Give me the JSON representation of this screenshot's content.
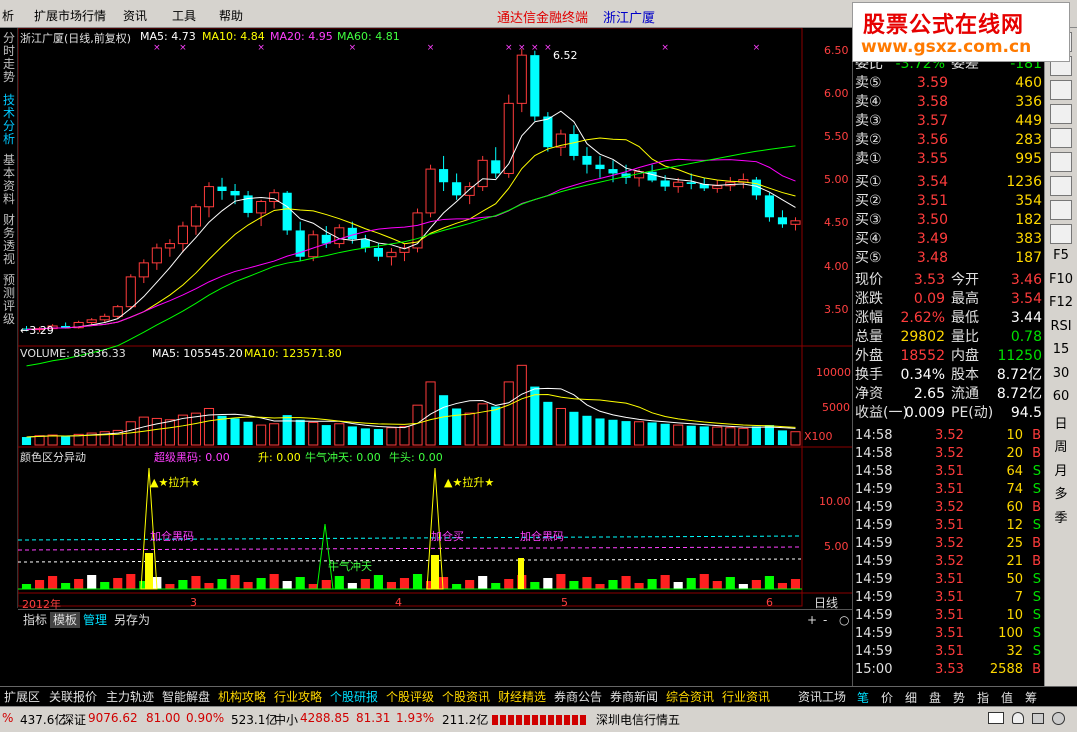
{
  "menu": {
    "items": [
      "析",
      "扩展市场行情",
      "资讯",
      "工具",
      "帮助"
    ],
    "brand": "通达信金融终端",
    "stock": "浙江广厦"
  },
  "logo": {
    "title": "股票公式在线网",
    "url": "www.gsxz.com.cn"
  },
  "left_tabs": [
    "分时走势",
    "技术分析",
    "基本资料",
    "财务透视",
    "预测评级"
  ],
  "main_header": {
    "name": "浙江广厦(日线,前复权)",
    "ma5": "MA5: 4.73",
    "ma10": "MA10: 4.84",
    "ma20": "MA20: 4.95",
    "ma60": "MA60: 4.81"
  },
  "price_axis": [
    "6.50",
    "6.00",
    "5.50",
    "5.00",
    "4.50",
    "4.00",
    "3.50"
  ],
  "price_marks": {
    "high": "6.52",
    "low": "3.29"
  },
  "volume_header": {
    "label": "VOLUME: 85836.33",
    "ma5": "MA5: 105545.20",
    "ma10": "MA10: 123571.80"
  },
  "volume_axis": [
    "10000",
    "5000",
    "X100"
  ],
  "indicator_header": {
    "name": "颜色区分异动",
    "v1": "超级黑码: 0.00",
    "v2": "升: 0.00",
    "v3": "牛气冲天: 0.00",
    "v4": "牛头: 0.00"
  },
  "indicator_axis": [
    "10.00",
    "5.00"
  ],
  "indicator_labels": {
    "lift1": "▲★拉升★",
    "lift2": "▲★拉升★",
    "heima1": "加仓黑码",
    "heima2": "加仓黑码",
    "jiacang": "加仓买",
    "niu": "牛气冲天"
  },
  "time_axis": [
    "2012年",
    "3",
    "4",
    "5",
    "6"
  ],
  "period": "日线",
  "chart_toolbar": [
    "指标",
    "模板",
    "管理",
    "另存为"
  ],
  "quote": {
    "weibi_label": "委比",
    "weibi": "-3.72%",
    "weicha_label": "委差",
    "weicha": "-181",
    "sell": [
      {
        "label": "卖⑤",
        "price": "3.59",
        "vol": "460"
      },
      {
        "label": "卖④",
        "price": "3.58",
        "vol": "336"
      },
      {
        "label": "卖③",
        "price": "3.57",
        "vol": "449"
      },
      {
        "label": "卖②",
        "price": "3.56",
        "vol": "283"
      },
      {
        "label": "卖①",
        "price": "3.55",
        "vol": "995"
      }
    ],
    "buy": [
      {
        "label": "买①",
        "price": "3.54",
        "vol": "1236"
      },
      {
        "label": "买②",
        "price": "3.51",
        "vol": "354"
      },
      {
        "label": "买③",
        "price": "3.50",
        "vol": "182"
      },
      {
        "label": "买④",
        "price": "3.49",
        "vol": "383"
      },
      {
        "label": "买⑤",
        "price": "3.48",
        "vol": "187"
      }
    ],
    "stats": [
      {
        "l1": "现价",
        "v1": "3.53",
        "c1": "red",
        "l2": "今开",
        "v2": "3.46",
        "c2": "red"
      },
      {
        "l1": "涨跌",
        "v1": "0.09",
        "c1": "red",
        "l2": "最高",
        "v2": "3.54",
        "c2": "red"
      },
      {
        "l1": "涨幅",
        "v1": "2.62%",
        "c1": "red",
        "l2": "最低",
        "v2": "3.44",
        "c2": "white"
      },
      {
        "l1": "总量",
        "v1": "29802",
        "c1": "yellow",
        "l2": "量比",
        "v2": "0.78",
        "c2": "green"
      },
      {
        "l1": "外盘",
        "v1": "18552",
        "c1": "red",
        "l2": "内盘",
        "v2": "11250",
        "c2": "green"
      },
      {
        "l1": "换手",
        "v1": "0.34%",
        "c1": "white",
        "l2": "股本",
        "v2": "8.72亿",
        "c2": "white"
      },
      {
        "l1": "净资",
        "v1": "2.65",
        "c1": "white",
        "l2": "流通",
        "v2": "8.72亿",
        "c2": "white"
      },
      {
        "l1": "收益(一)",
        "v1": "0.009",
        "c1": "white",
        "l2": "PE(动)",
        "v2": "94.5",
        "c2": "white"
      }
    ],
    "ticks": [
      {
        "t": "14:58",
        "p": "3.52",
        "v": "10",
        "s": "B"
      },
      {
        "t": "14:58",
        "p": "3.52",
        "v": "20",
        "s": "B"
      },
      {
        "t": "14:58",
        "p": "3.51",
        "v": "64",
        "s": "S"
      },
      {
        "t": "14:59",
        "p": "3.51",
        "v": "74",
        "s": "S"
      },
      {
        "t": "14:59",
        "p": "3.52",
        "v": "60",
        "s": "B"
      },
      {
        "t": "14:59",
        "p": "3.51",
        "v": "12",
        "s": "S"
      },
      {
        "t": "14:59",
        "p": "3.52",
        "v": "25",
        "s": "B"
      },
      {
        "t": "14:59",
        "p": "3.52",
        "v": "21",
        "s": "B"
      },
      {
        "t": "14:59",
        "p": "3.51",
        "v": "50",
        "s": "S"
      },
      {
        "t": "14:59",
        "p": "3.51",
        "v": "7",
        "s": "S"
      },
      {
        "t": "14:59",
        "p": "3.51",
        "v": "10",
        "s": "S"
      },
      {
        "t": "14:59",
        "p": "3.51",
        "v": "100",
        "s": "S"
      },
      {
        "t": "14:59",
        "p": "3.51",
        "v": "32",
        "s": "S"
      },
      {
        "t": "15:00",
        "p": "3.53",
        "v": "2588",
        "s": "B"
      }
    ]
  },
  "icons": [
    "F5",
    "F10",
    "F12",
    "RSI",
    "15",
    "30",
    "60",
    "日",
    "周",
    "月",
    "多",
    "季"
  ],
  "bottom_nav": [
    "扩展区",
    "关联报价",
    "主力轨迹",
    "智能解盘",
    "机构攻略",
    "行业攻略",
    "个股研报",
    "个股评级",
    "个股资讯",
    "财经精选",
    "券商公告",
    "券商新闻",
    "综合资讯",
    "行业资讯",
    "资讯工场"
  ],
  "bottom_right": [
    "笔",
    "价",
    "细",
    "盘",
    "势",
    "指",
    "值",
    "筹"
  ],
  "status": {
    "s0": "%",
    "s1": "437.6亿",
    "s2": "深证",
    "s3": "9076.62",
    "s4": "81.00",
    "s5": "0.90%",
    "s6": "523.1亿",
    "s7": "中小",
    "s8": "4288.85",
    "s9": "81.31",
    "s10": "1.93%",
    "s11": "211.2亿",
    "s12": "深圳电信行情五"
  },
  "colors": {
    "up": "#ff3c3c",
    "down": "#00ffff",
    "ma5": "#ffffff",
    "ma10": "#ffff00",
    "ma20": "#ff00ff",
    "ma60": "#00ff00"
  },
  "chart_data": {
    "type": "candlestick",
    "title": "浙江广厦(日线,前复权)",
    "ylim": [
      3.2,
      6.6
    ],
    "candles": [
      [
        3.33,
        3.36,
        3.3,
        3.32
      ],
      [
        3.32,
        3.35,
        3.29,
        3.33
      ],
      [
        3.33,
        3.38,
        3.31,
        3.36
      ],
      [
        3.36,
        3.4,
        3.33,
        3.34
      ],
      [
        3.34,
        3.42,
        3.33,
        3.4
      ],
      [
        3.4,
        3.45,
        3.37,
        3.43
      ],
      [
        3.43,
        3.5,
        3.4,
        3.47
      ],
      [
        3.47,
        3.6,
        3.45,
        3.58
      ],
      [
        3.58,
        3.95,
        3.55,
        3.92
      ],
      [
        3.92,
        4.12,
        3.85,
        4.08
      ],
      [
        4.08,
        4.3,
        4.0,
        4.25
      ],
      [
        4.25,
        4.35,
        4.15,
        4.3
      ],
      [
        4.3,
        4.55,
        4.2,
        4.5
      ],
      [
        4.5,
        4.75,
        4.4,
        4.72
      ],
      [
        4.72,
        5.0,
        4.6,
        4.95
      ],
      [
        4.95,
        5.05,
        4.8,
        4.9
      ],
      [
        4.9,
        4.98,
        4.75,
        4.85
      ],
      [
        4.85,
        4.9,
        4.6,
        4.65
      ],
      [
        4.65,
        4.8,
        4.5,
        4.78
      ],
      [
        4.78,
        4.92,
        4.7,
        4.88
      ],
      [
        4.88,
        4.9,
        4.4,
        4.45
      ],
      [
        4.45,
        4.55,
        4.1,
        4.15
      ],
      [
        4.15,
        4.45,
        4.1,
        4.4
      ],
      [
        4.4,
        4.5,
        4.25,
        4.3
      ],
      [
        4.3,
        4.52,
        4.25,
        4.48
      ],
      [
        4.48,
        4.55,
        4.3,
        4.35
      ],
      [
        4.35,
        4.4,
        4.2,
        4.25
      ],
      [
        4.25,
        4.3,
        4.1,
        4.15
      ],
      [
        4.15,
        4.25,
        4.05,
        4.2
      ],
      [
        4.2,
        4.3,
        4.1,
        4.25
      ],
      [
        4.25,
        4.7,
        4.2,
        4.65
      ],
      [
        4.65,
        5.2,
        4.6,
        5.15
      ],
      [
        5.15,
        5.3,
        4.9,
        5.0
      ],
      [
        5.0,
        5.1,
        4.8,
        4.85
      ],
      [
        4.85,
        5.0,
        4.75,
        4.95
      ],
      [
        4.95,
        5.3,
        4.9,
        5.25
      ],
      [
        5.25,
        5.4,
        5.05,
        5.1
      ],
      [
        5.1,
        6.0,
        5.05,
        5.9
      ],
      [
        5.9,
        6.52,
        5.8,
        6.45
      ],
      [
        6.45,
        6.5,
        5.7,
        5.75
      ],
      [
        5.75,
        5.8,
        5.35,
        5.4
      ],
      [
        5.4,
        5.6,
        5.3,
        5.55
      ],
      [
        5.55,
        5.65,
        5.25,
        5.3
      ],
      [
        5.3,
        5.4,
        5.1,
        5.2
      ],
      [
        5.2,
        5.3,
        5.05,
        5.15
      ],
      [
        5.15,
        5.25,
        5.0,
        5.1
      ],
      [
        5.1,
        5.2,
        4.98,
        5.05
      ],
      [
        5.05,
        5.15,
        4.95,
        5.12
      ],
      [
        5.12,
        5.2,
        5.0,
        5.02
      ],
      [
        5.02,
        5.08,
        4.9,
        4.95
      ],
      [
        4.95,
        5.05,
        4.88,
        5.0
      ],
      [
        5.0,
        5.1,
        4.92,
        4.98
      ],
      [
        4.98,
        5.05,
        4.9,
        4.93
      ],
      [
        4.93,
        5.02,
        4.88,
        4.96
      ],
      [
        4.96,
        5.06,
        4.9,
        5.0
      ],
      [
        5.0,
        5.1,
        4.93,
        5.03
      ],
      [
        5.03,
        5.06,
        4.8,
        4.85
      ],
      [
        4.85,
        4.88,
        4.55,
        4.6
      ],
      [
        4.6,
        4.68,
        4.48,
        4.52
      ],
      [
        4.52,
        4.6,
        4.45,
        4.56
      ]
    ],
    "volume": [
      12,
      14,
      15,
      13,
      16,
      18,
      20,
      22,
      35,
      42,
      40,
      38,
      45,
      48,
      55,
      44,
      40,
      35,
      30,
      32,
      45,
      38,
      34,
      30,
      32,
      28,
      25,
      24,
      26,
      28,
      60,
      95,
      75,
      55,
      48,
      62,
      58,
      95,
      120,
      88,
      65,
      55,
      50,
      44,
      40,
      38,
      36,
      35,
      34,
      32,
      30,
      29,
      28,
      27,
      26,
      25,
      28,
      30,
      22,
      20
    ],
    "volume_axis_ticks": [
      10000,
      5000
    ],
    "volume_unit": "X100"
  }
}
